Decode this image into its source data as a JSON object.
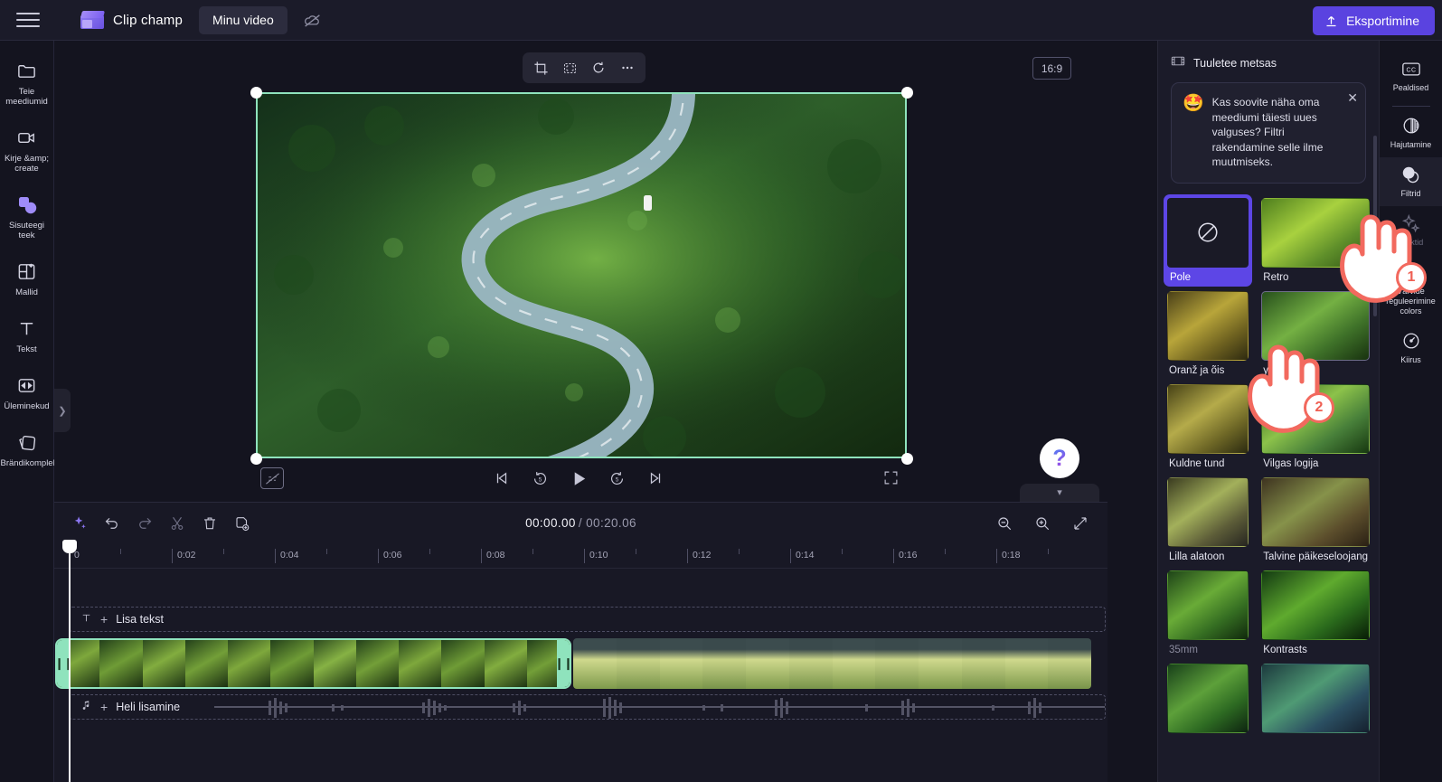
{
  "app": {
    "brand_name": "Clip champ",
    "project_name": "Minu video",
    "export_label": "Eksportimine"
  },
  "left_rail": {
    "items": [
      {
        "label": "Teie meediumid",
        "icon": "folder-icon",
        "dim": false
      },
      {
        "label": "Kirje &amp; create",
        "icon": "video-camera-icon",
        "dim": false
      },
      {
        "label": "Sisuteegi teek",
        "icon": "content-library-icon",
        "dim": false,
        "active": true
      },
      {
        "label": "Mallid",
        "icon": "templates-icon",
        "dim": false
      },
      {
        "label": "Tekst",
        "icon": "text-icon",
        "dim": false
      },
      {
        "label": "Üleminekud",
        "icon": "transitions-icon",
        "dim": false
      },
      {
        "label": "Brändikomplekt",
        "icon": "brand-kit-icon",
        "dim": false
      }
    ]
  },
  "stage": {
    "ratio_badge": "16:9",
    "tools": [
      "crop-icon",
      "fit-icon",
      "rotate-icon",
      "more-options-icon"
    ],
    "transport": [
      "skip-back-icon",
      "rewind-5-icon",
      "play-icon",
      "forward-5-icon",
      "skip-forward-icon"
    ],
    "captions_off_icon": "captions-off-icon",
    "fullscreen_icon": "fullscreen-icon",
    "help_label": "?",
    "collapse_icon": "chevron-down-icon"
  },
  "timeline": {
    "current_time": "00:00.00",
    "total_time": "/ 00:20.06",
    "tools": [
      "ai-sparkle-icon",
      "undo-icon",
      "redo-icon",
      "split-scissors-icon",
      "delete-trash-icon",
      "duplicate-icon"
    ],
    "zoom_out_icon": "zoom-out-icon",
    "zoom_in_icon": "zoom-in-icon",
    "fit_timeline_icon": "fit-to-timeline-icon",
    "ruler_ticks": [
      "0",
      "0:02",
      "0:04",
      "0:06",
      "0:08",
      "0:10",
      "0:12",
      "0:14",
      "0:16",
      "0:18"
    ],
    "text_track_label": "Lisa tekst",
    "audio_track_label": "Heli lisamine"
  },
  "right_panel": {
    "header_title": "Tuuletee metsas",
    "header_icon": "film-strip-icon",
    "tip": {
      "emoji": "🤩",
      "text": "Kas soovite näha oma meediumi täiesti uues valguses? Filtri rakendamine selle ilme muutmiseks.",
      "close_icon": "close-icon"
    },
    "filters": [
      {
        "label": "Pole",
        "selected": true,
        "icon": "no-filter-icon",
        "grad": "none"
      },
      {
        "label": "Retro",
        "selected": false,
        "grad": "retro"
      },
      {
        "label": "Oranž ja õis",
        "selected": false,
        "grad": "orange"
      },
      {
        "label": "you",
        "selected": false,
        "grad": "hover",
        "hovered": true
      },
      {
        "label": "Kuldne tund",
        "selected": false,
        "grad": "golden"
      },
      {
        "label": "Vilgas logija",
        "selected": false,
        "grad": "vivid"
      },
      {
        "label": "Lilla alatoon",
        "selected": false,
        "grad": "purple"
      },
      {
        "label": "Talvine päikeseloojang",
        "selected": false,
        "grad": "winter"
      },
      {
        "label": "35mm",
        "selected": false,
        "grad": "film",
        "dim": true
      },
      {
        "label": "Kontrasts",
        "selected": false,
        "grad": "contrast"
      },
      {
        "label": "",
        "selected": false,
        "grad": "extra1"
      },
      {
        "label": "",
        "selected": false,
        "grad": "extra2"
      }
    ]
  },
  "far_rail": {
    "items": [
      {
        "label": "Pealdised",
        "icon": "closed-captions-icon",
        "dim": false
      },
      {
        "label": "Hajutamine",
        "icon": "fade-icon",
        "dim": false
      },
      {
        "label": "Filtrid",
        "icon": "filters-icon",
        "dim": false,
        "active": true
      },
      {
        "label": "Efektid",
        "icon": "effects-icon",
        "dim": true
      },
      {
        "label": "Värvide reguleerimine colors",
        "icon": "color-adjust-icon",
        "dim": false
      },
      {
        "label": "Kiirus",
        "icon": "speed-icon",
        "dim": false
      }
    ]
  },
  "cursors": [
    {
      "badge": "1"
    },
    {
      "badge": "2"
    }
  ]
}
